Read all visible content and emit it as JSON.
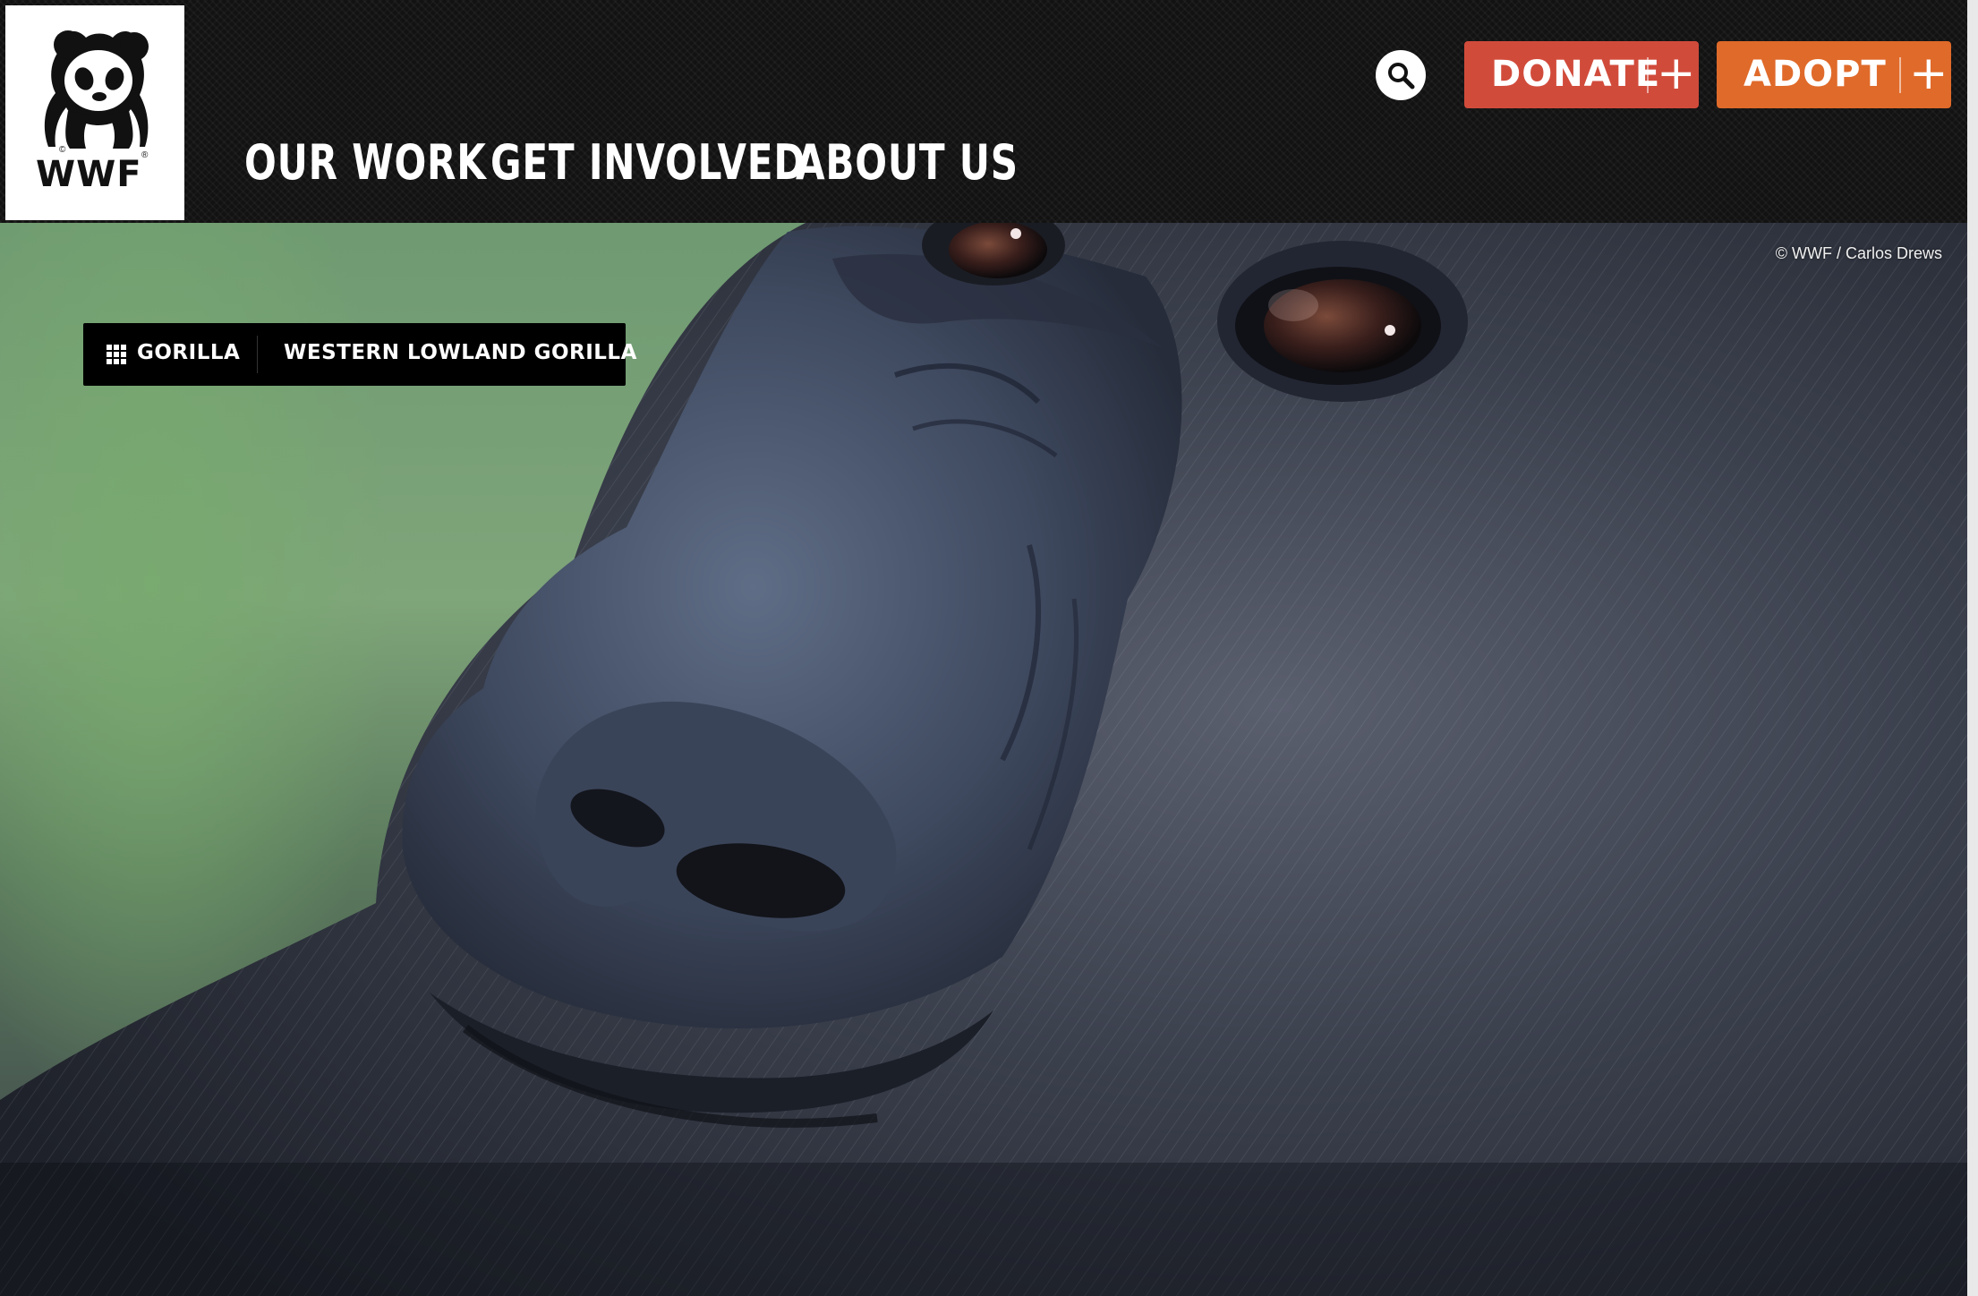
{
  "header": {
    "logo": {
      "text": "WWF",
      "icon": "panda-logo-icon"
    },
    "nav": {
      "our_work": "OUR WORK",
      "get_involved": "GET INVOLVED",
      "about_us": "ABOUT US"
    },
    "search": {
      "icon": "search-icon"
    },
    "donate": {
      "label": "DONATE",
      "plus": "+",
      "color": "#d14b3b"
    },
    "adopt": {
      "label": "ADOPT",
      "plus": "+",
      "color": "#e06a2a"
    }
  },
  "hero": {
    "credit": "© WWF / Carlos Drews",
    "breadcrumb": {
      "icon": "grid-icon",
      "items": [
        "GORILLA",
        "WESTERN LOWLAND GORILLA"
      ]
    }
  }
}
